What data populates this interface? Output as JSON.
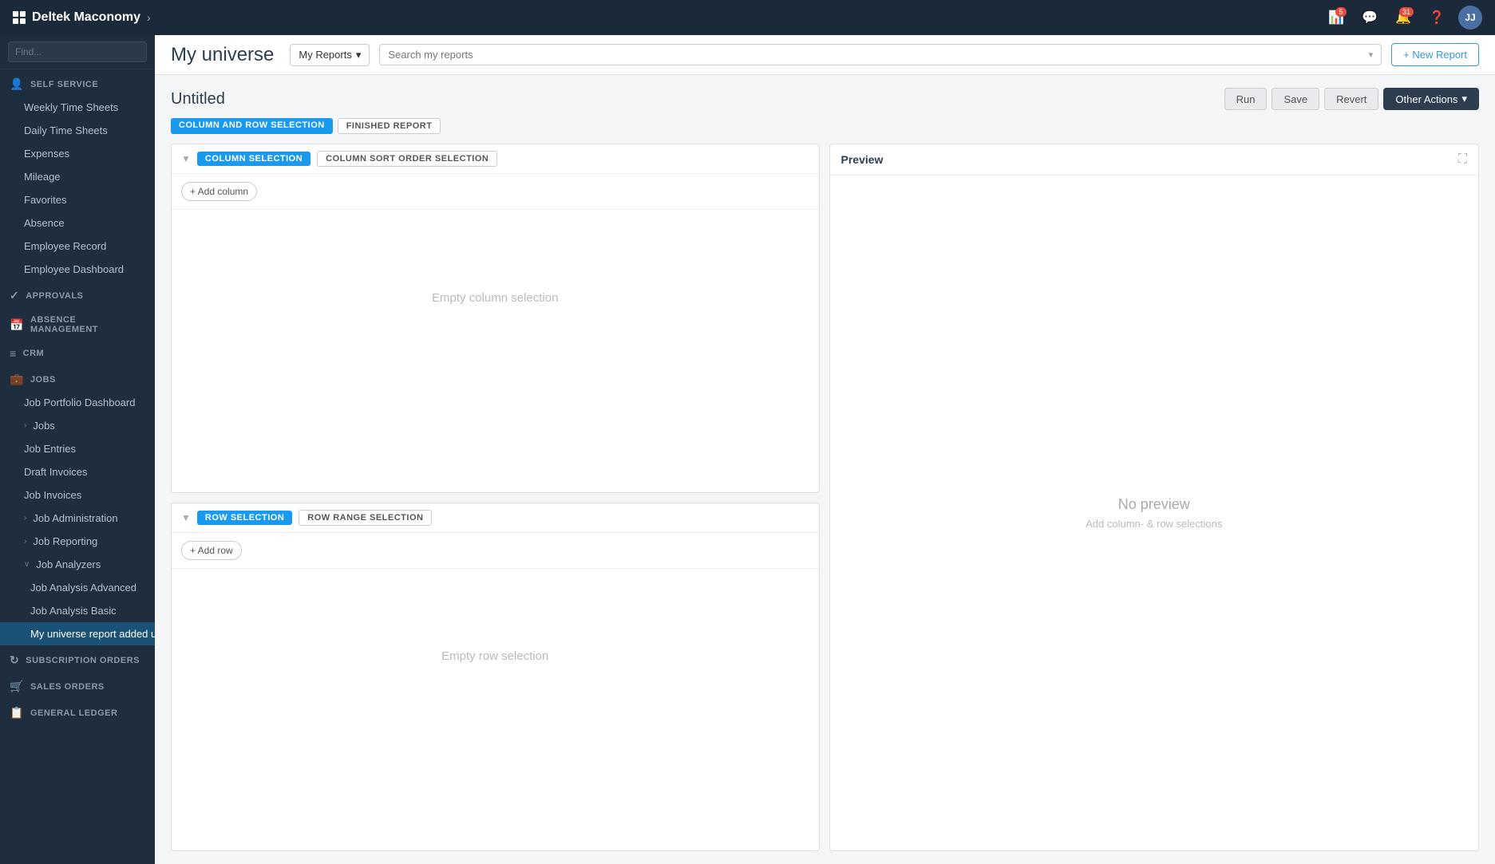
{
  "app": {
    "logo": "Deltek Maconomy",
    "nav_chevron": "›"
  },
  "topnav": {
    "notification_badge": "5",
    "chat_badge": "",
    "alert_badge": "31",
    "avatar": "JJ"
  },
  "sidebar": {
    "search_placeholder": "Find...",
    "sections": [
      {
        "id": "self-service",
        "label": "SELF SERVICE",
        "icon": "person",
        "items": [
          {
            "id": "weekly-time-sheets",
            "label": "Weekly Time Sheets",
            "sub": true
          },
          {
            "id": "daily-time-sheets",
            "label": "Daily Time Sheets",
            "sub": true
          },
          {
            "id": "expenses",
            "label": "Expenses",
            "sub": true
          },
          {
            "id": "mileage",
            "label": "Mileage",
            "sub": true
          },
          {
            "id": "favorites",
            "label": "Favorites",
            "sub": true
          },
          {
            "id": "absence",
            "label": "Absence",
            "sub": true
          },
          {
            "id": "employee-record",
            "label": "Employee Record",
            "sub": true
          },
          {
            "id": "employee-dashboard",
            "label": "Employee Dashboard",
            "sub": true
          }
        ]
      },
      {
        "id": "approvals",
        "label": "APPROVALS",
        "icon": "check",
        "items": []
      },
      {
        "id": "absence-management",
        "label": "ABSENCE MANAGEMENT",
        "icon": "calendar",
        "items": []
      },
      {
        "id": "crm",
        "label": "CRM",
        "icon": "people",
        "items": []
      },
      {
        "id": "jobs",
        "label": "JOBS",
        "icon": "briefcase",
        "items": [
          {
            "id": "job-portfolio-dashboard",
            "label": "Job Portfolio Dashboard",
            "sub": true
          },
          {
            "id": "jobs-item",
            "label": "Jobs",
            "sub": true,
            "expandable": true
          },
          {
            "id": "job-entries",
            "label": "Job Entries",
            "sub": true
          },
          {
            "id": "draft-invoices",
            "label": "Draft Invoices",
            "sub": true
          },
          {
            "id": "job-invoices",
            "label": "Job Invoices",
            "sub": true
          },
          {
            "id": "job-administration",
            "label": "Job Administration",
            "sub": true,
            "expandable": true
          },
          {
            "id": "job-reporting",
            "label": "Job Reporting",
            "sub": true,
            "expandable": true
          },
          {
            "id": "job-analyzers",
            "label": "Job Analyzers",
            "sub": true,
            "expanded": true,
            "expandable": true
          },
          {
            "id": "job-analysis-advanced",
            "label": "Job Analysis Advanced",
            "sub2": true
          },
          {
            "id": "job-analysis-basic",
            "label": "Job Analysis Basic",
            "sub2": true
          },
          {
            "id": "my-universe-report",
            "label": "My universe report added using the extender",
            "sub2": true,
            "active": true
          }
        ]
      },
      {
        "id": "subscription-orders",
        "label": "SUBSCRIPTION ORDERS",
        "icon": "refresh",
        "items": []
      },
      {
        "id": "sales-orders",
        "label": "SALES ORDERS",
        "icon": "cart",
        "items": []
      },
      {
        "id": "general-ledger",
        "label": "GENERAL LEDGER",
        "icon": "book",
        "items": []
      }
    ]
  },
  "toolbar": {
    "page_title": "My universe",
    "my_reports_label": "My Reports",
    "search_placeholder": "Search my reports",
    "new_report_label": "+ New Report"
  },
  "report": {
    "title": "Untitled",
    "run_label": "Run",
    "save_label": "Save",
    "revert_label": "Revert",
    "other_actions_label": "Other Actions",
    "tab_column_row": "COLUMN AND ROW SELECTION",
    "tab_finished": "FINISHED REPORT"
  },
  "column_panel": {
    "tab_column_selection": "COLUMN SELECTION",
    "tab_column_sort": "COLUMN SORT ORDER SELECTION",
    "add_column_label": "+ Add column",
    "empty_label": "Empty column selection"
  },
  "row_panel": {
    "tab_row_selection": "ROW SELECTION",
    "tab_row_range": "ROW RANGE SELECTION",
    "add_row_label": "+ Add row",
    "empty_label": "Empty row selection"
  },
  "preview": {
    "title": "Preview",
    "no_preview": "No preview",
    "hint": "Add column- & row selections"
  }
}
